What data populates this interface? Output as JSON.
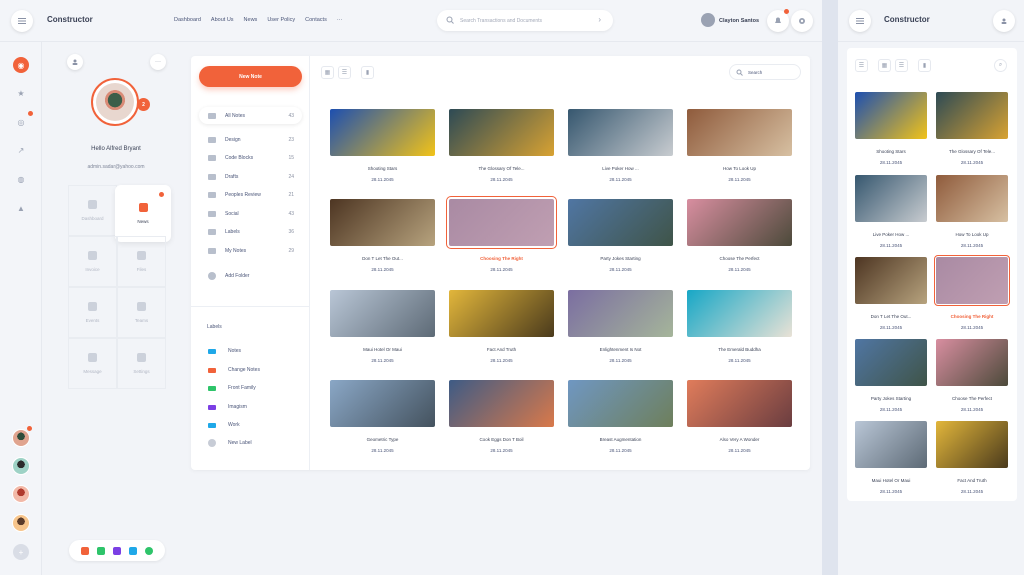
{
  "header": {
    "brand": "Constructor",
    "nav": [
      "Dashboard",
      "About Us",
      "News",
      "User Policy",
      "Contacts"
    ],
    "more": "···",
    "search_placeholder": "Search Transactions and Documents",
    "user_name": "Clayton Santos"
  },
  "profile": {
    "name": "Hello Alfred Bryant",
    "email": "admin.sadar@yahoo.com",
    "badge": "2"
  },
  "tiles": [
    {
      "label": "Dashboard"
    },
    {
      "label": "News"
    },
    {
      "label": "Invoice"
    },
    {
      "label": "Files"
    },
    {
      "label": "Events"
    },
    {
      "label": "Teams"
    },
    {
      "label": "Message"
    },
    {
      "label": "Settings"
    }
  ],
  "folders": {
    "new_note": "New Note",
    "items": [
      {
        "name": "All Notes",
        "count": "43"
      },
      {
        "name": "Design",
        "count": "23"
      },
      {
        "name": "Code Blocks",
        "count": "15"
      },
      {
        "name": "Drafts",
        "count": "24"
      },
      {
        "name": "Peoples Review",
        "count": "21"
      },
      {
        "name": "Social",
        "count": "43"
      },
      {
        "name": "Labels",
        "count": "36"
      },
      {
        "name": "My Notes",
        "count": "29"
      }
    ],
    "add_folder": "Add Folder"
  },
  "labels": {
    "heading": "Labels",
    "items": [
      {
        "name": "Notes",
        "color": "#1fa8e8"
      },
      {
        "name": "Change Notes",
        "color": "#f1623a"
      },
      {
        "name": "Front Family",
        "color": "#2ec46a"
      },
      {
        "name": "Imagism",
        "color": "#7b3fe4"
      },
      {
        "name": "Work",
        "color": "#1fa8e8"
      }
    ],
    "new_label": "New Label"
  },
  "search": {
    "placeholder": "Search"
  },
  "notes": [
    {
      "title": "Shooting Stars",
      "date": "28.11.2045",
      "c1": "#1d4fb0",
      "c2": "#f2c318"
    },
    {
      "title": "The Glossary Of Tele...",
      "date": "28.11.2045",
      "c1": "#2d4a55",
      "c2": "#d8a232"
    },
    {
      "title": "Live Poker How ...",
      "date": "28.11.2045",
      "c1": "#36576f",
      "c2": "#c8ccd0"
    },
    {
      "title": "How To Look Up",
      "date": "28.11.2045",
      "c1": "#8f5b3c",
      "c2": "#d7c0a2"
    },
    {
      "title": "Don T Let The Out...",
      "date": "28.11.2045",
      "c1": "#4d3522",
      "c2": "#b7a37e"
    },
    {
      "title": "Choosing The Right",
      "date": "28.11.2045",
      "c1": "#a98aa3",
      "c2": "#c09fb2"
    },
    {
      "title": "Party Jokes Starting",
      "date": "28.11.2045",
      "c1": "#5076a3",
      "c2": "#3f5448"
    },
    {
      "title": "Choose The Perfect",
      "date": "28.11.2045",
      "c1": "#d88ea0",
      "c2": "#4c4a3a"
    },
    {
      "title": "Maui Hotel Or Maui",
      "date": "28.11.2045",
      "c1": "#b9c6d6",
      "c2": "#5d6a76"
    },
    {
      "title": "Fact And Truth",
      "date": "28.11.2045",
      "c1": "#e2b63b",
      "c2": "#4a3a1c"
    },
    {
      "title": "Enlightenment Is Not",
      "date": "28.11.2045",
      "c1": "#7b6ea1",
      "c2": "#a5b59a"
    },
    {
      "title": "The Emerald Buddha",
      "date": "28.11.2045",
      "c1": "#17a7c6",
      "c2": "#e9e2d6"
    },
    {
      "title": "Geometric Type",
      "date": "28.11.2045",
      "c1": "#8aa7c6",
      "c2": "#44525e"
    },
    {
      "title": "Cook Eggs Don T Boil",
      "date": "28.11.2045",
      "c1": "#3e5b85",
      "c2": "#d9794a"
    },
    {
      "title": "Breast Augmentation",
      "date": "28.11.2045",
      "c1": "#6f97c2",
      "c2": "#6e7f5b"
    },
    {
      "title": "Also Very A Wonder",
      "date": "28.11.2045",
      "c1": "#e07c5b",
      "c2": "#6a3d40"
    }
  ],
  "right_panel": {
    "brand": "Constructor",
    "notes": [
      {
        "title": "Shooting Stars",
        "date": "28.11.2045"
      },
      {
        "title": "The Glossary Of Tele...",
        "date": "28.11.2045"
      },
      {
        "title": "Live Poker How ...",
        "date": "28.11.2045"
      },
      {
        "title": "How To Look Up",
        "date": "28.11.2045"
      },
      {
        "title": "Don T Let The Out...",
        "date": "28.11.2045"
      },
      {
        "title": "Choosing The Right",
        "date": "28.11.2045"
      },
      {
        "title": "Party Jokes Starting",
        "date": "28.11.2045"
      },
      {
        "title": "Choose The Perfect",
        "date": "28.11.2045"
      },
      {
        "title": "Maui Hotel Or Maui",
        "date": "28.11.2045"
      },
      {
        "title": "Fact And Truth",
        "date": "28.11.2045"
      }
    ]
  },
  "colors": {
    "accent": "#f1623a",
    "background": "#f2f4f8"
  },
  "icons": [
    "menu-icon",
    "search-icon",
    "user-icon",
    "bell-icon",
    "settings-icon",
    "compass-icon",
    "star-icon",
    "messenger-icon",
    "trend-icon",
    "globe-icon",
    "home-icon"
  ]
}
